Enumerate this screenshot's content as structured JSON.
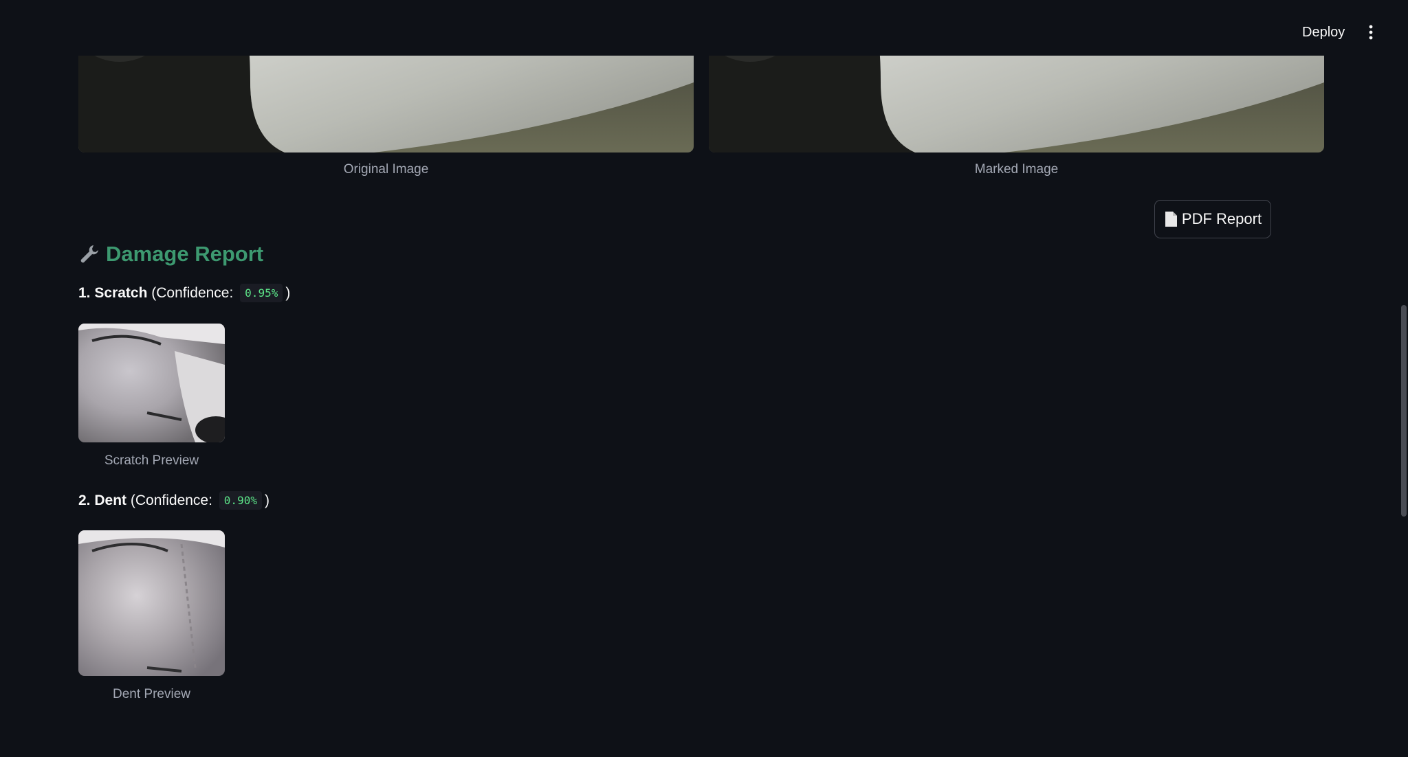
{
  "header": {
    "deploy_label": "Deploy",
    "menu_icon": "vertical-dots-icon"
  },
  "images": {
    "original_caption": "Original Image",
    "marked_caption": "Marked Image"
  },
  "pdf_button": {
    "icon": "document-icon",
    "label": "PDF Report"
  },
  "report": {
    "icon": "wrench-icon",
    "title": "Damage Report",
    "items": [
      {
        "index": "1.",
        "type": "Scratch",
        "confidence_prefix": "(Confidence:",
        "confidence": "0.95%",
        "confidence_suffix": ")",
        "preview_caption": "Scratch Preview"
      },
      {
        "index": "2.",
        "type": "Dent",
        "confidence_prefix": "(Confidence:",
        "confidence": "0.90%",
        "confidence_suffix": ")",
        "preview_caption": "Dent Preview"
      }
    ]
  },
  "colors": {
    "background": "#0e1117",
    "heading_green": "#3d9970",
    "code_green": "#5ce488",
    "caption_gray": "#a3a8b4"
  }
}
